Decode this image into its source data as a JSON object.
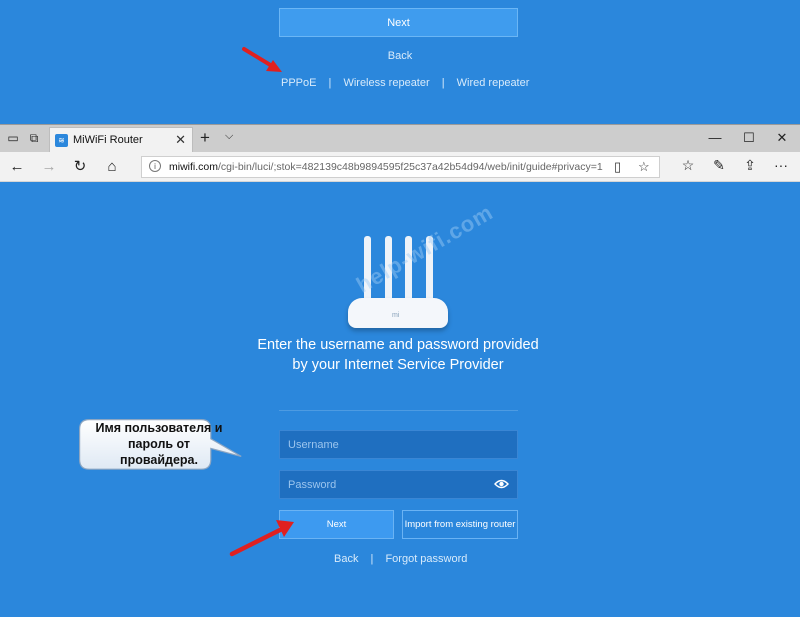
{
  "top_fragment": {
    "next_label": "Next",
    "back_label": "Back",
    "links": [
      "PPPoE",
      "Wireless repeater",
      "Wired repeater"
    ],
    "separator": "|"
  },
  "browser": {
    "tab_title": "MiWiFi Router",
    "url_host": "miwifi.com",
    "url_path": "/cgi-bin/luci/;stok=482139c48b9894595f25c37a42b54d94/web/init/guide#privacy=1"
  },
  "page": {
    "watermark": "help-wifi.com",
    "router_logo": "mi",
    "heading": "Enter the username and password provided by your Internet Service Provider",
    "username_placeholder": "Username",
    "password_placeholder": "Password",
    "next_label": "Next",
    "import_label": "Import from existing router",
    "back_label": "Back",
    "forgot_label": "Forgot password",
    "separator": "|"
  },
  "annotation": {
    "callout_text": "Имя пользователя и пароль от провайдера."
  },
  "colors": {
    "page_blue": "#2b87dc",
    "field_blue": "#1f6fc0",
    "arrow_red": "#e02020",
    "tab_bar": "#cdcdcd"
  },
  "icons": [
    "tab-preview-icon",
    "set-aside-icon",
    "miwifi-favicon",
    "close-icon",
    "plus-icon",
    "chevron-down-icon",
    "minimize-icon",
    "maximize-icon",
    "back-arrow-icon",
    "forward-arrow-icon",
    "refresh-icon",
    "home-icon",
    "info-icon",
    "reading-view-icon",
    "star-icon",
    "favorites-icon",
    "pen-icon",
    "share-icon",
    "more-icon",
    "eye-icon"
  ]
}
